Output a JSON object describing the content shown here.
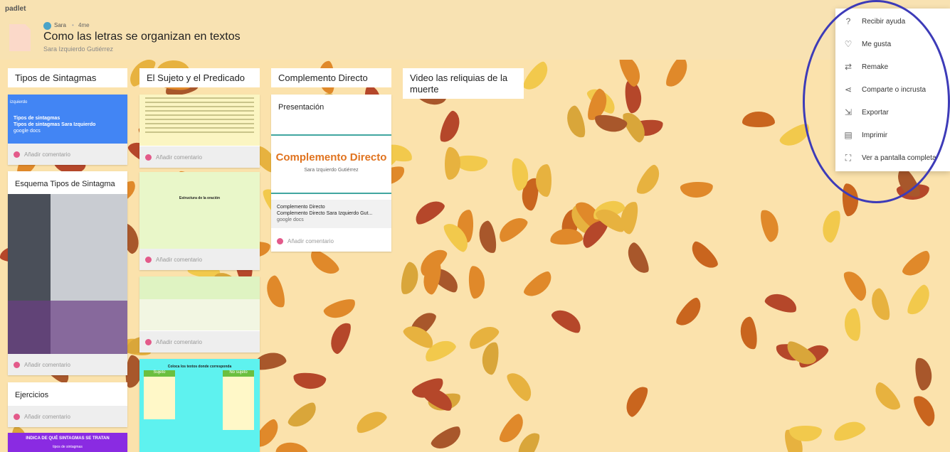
{
  "header": {
    "brand": "padlet",
    "author": "Sara",
    "time": "4me",
    "title": "Como las letras se organizan en textos",
    "subtitle": "Sara Izquierdo Gutiérrez"
  },
  "columns": [
    {
      "title": "Tipos de Sintagmas"
    },
    {
      "title": "El Sujeto y el Predicado"
    },
    {
      "title": "Complemento Directo"
    },
    {
      "title": "Video las reliquias de la muerte"
    }
  ],
  "cards": {
    "tipos_doc": {
      "source": "izquierdo",
      "title": "Tipos de sintagmas",
      "desc": "Tipos de sintagmas Sara Izquierdo",
      "type": "google docs"
    },
    "esquema": {
      "title": "Esquema Tipos de Sintagma"
    },
    "ejercicios": {
      "title": "Ejercicios"
    },
    "indica": {
      "title": "INDICA DE QUÉ SINTAGMAS SE TRATAN",
      "sub": "tipos de sintagmas"
    },
    "presentacion": {
      "title": "Presentación",
      "slide_title": "Complemento Directo",
      "slide_author": "Sara Izquierdo Gutiérrez",
      "doc_title": "Complemento Directo",
      "doc_desc": "Complemento Directo Sara Izquierdo Gut...",
      "type": "google docs"
    },
    "estructura": {
      "title": "Estructura de la oración"
    },
    "sujeto_game": {
      "title": "Coloca los textos donde corresponda",
      "left": "Sujeto",
      "right": "No sujeto"
    }
  },
  "comment_label": "Añadir comentario",
  "menu": [
    {
      "label": "Recibir ayuda",
      "icon": "help-icon"
    },
    {
      "label": "Me gusta",
      "icon": "heart-icon"
    },
    {
      "label": "Remake",
      "icon": "remake-icon"
    },
    {
      "label": "Comparte o incrusta",
      "icon": "share-icon"
    },
    {
      "label": "Exportar",
      "icon": "export-icon"
    },
    {
      "label": "Imprimir",
      "icon": "print-icon"
    },
    {
      "label": "Ver a pantalla completa",
      "icon": "fullscreen-icon"
    }
  ],
  "colors": {
    "wallpaper": "#fbe2ac",
    "accent_circle": "#3d3bb8",
    "doc_blue": "#4285f4",
    "purple_card": "#8a2be2"
  }
}
